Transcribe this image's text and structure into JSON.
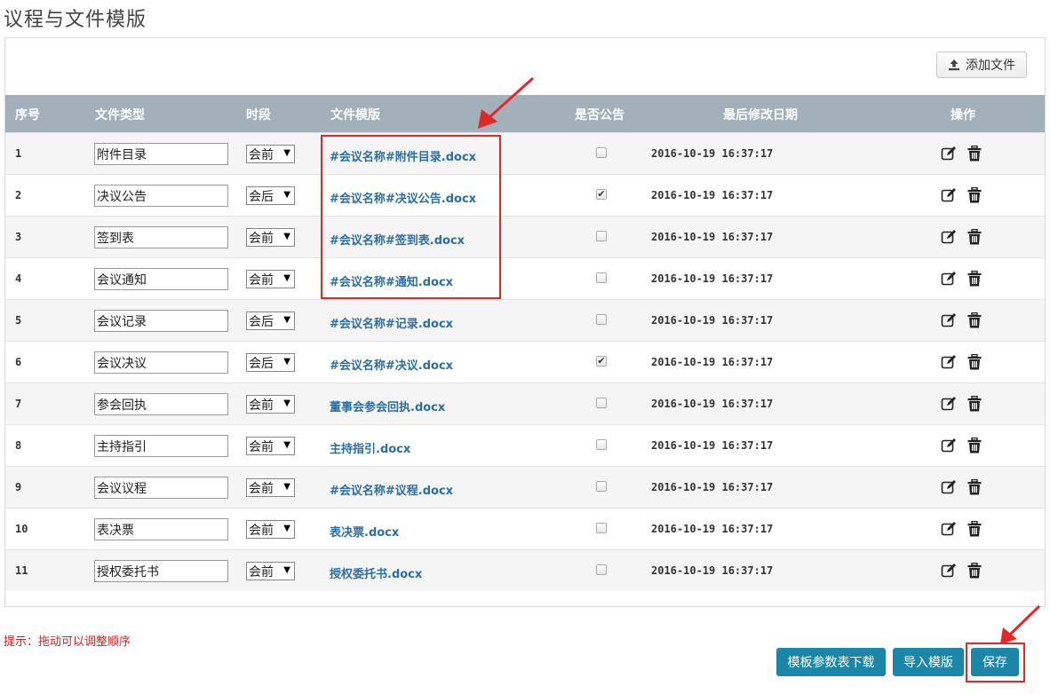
{
  "page": {
    "title": "议程与文件模版",
    "add_file_label": "添加文件",
    "hint": "提示：拖动可以调整顺序"
  },
  "table": {
    "headers": {
      "no": "序号",
      "type": "文件类型",
      "period": "时段",
      "template": "文件模版",
      "public": "是否公告",
      "modified": "最后修改日期",
      "actions": "操作"
    },
    "rows": [
      {
        "no": "1",
        "type": "附件目录",
        "period": "会前",
        "file": "#会议名称#附件目录.docx",
        "public": false,
        "date": "2016-10-19 16:37:17"
      },
      {
        "no": "2",
        "type": "决议公告",
        "period": "会后",
        "file": "#会议名称#决议公告.docx",
        "public": true,
        "date": "2016-10-19 16:37:17"
      },
      {
        "no": "3",
        "type": "签到表",
        "period": "会前",
        "file": "#会议名称#签到表.docx",
        "public": false,
        "date": "2016-10-19 16:37:17"
      },
      {
        "no": "4",
        "type": "会议通知",
        "period": "会前",
        "file": "#会议名称#通知.docx",
        "public": false,
        "date": "2016-10-19 16:37:17"
      },
      {
        "no": "5",
        "type": "会议记录",
        "period": "会后",
        "file": "#会议名称#记录.docx",
        "public": false,
        "date": "2016-10-19 16:37:17"
      },
      {
        "no": "6",
        "type": "会议决议",
        "period": "会后",
        "file": "#会议名称#决议.docx",
        "public": true,
        "date": "2016-10-19 16:37:17"
      },
      {
        "no": "7",
        "type": "参会回执",
        "period": "会前",
        "file": "董事会参会回执.docx",
        "public": false,
        "date": "2016-10-19 16:37:17"
      },
      {
        "no": "8",
        "type": "主持指引",
        "period": "会前",
        "file": "主持指引.docx",
        "public": false,
        "date": "2016-10-19 16:37:17"
      },
      {
        "no": "9",
        "type": "会议议程",
        "period": "会前",
        "file": "#会议名称#议程.docx",
        "public": false,
        "date": "2016-10-19 16:37:17"
      },
      {
        "no": "10",
        "type": "表决票",
        "period": "会前",
        "file": "表决票.docx",
        "public": false,
        "date": "2016-10-19 16:37:17"
      },
      {
        "no": "11",
        "type": "授权委托书",
        "period": "会前",
        "file": "授权委托书.docx",
        "public": false,
        "date": "2016-10-19 16:37:17"
      }
    ]
  },
  "buttons": {
    "download_params": "模板参数表下载",
    "import_template": "导入模版",
    "save": "保存"
  },
  "icons": {
    "upload": "upload-icon",
    "edit": "edit-icon",
    "delete": "trash-icon",
    "select_arrow": "▼",
    "check": "✔"
  },
  "colors": {
    "header_bg": "#a2b0bb",
    "link": "#2a6ea6",
    "button": "#1b86a8",
    "annotation": "#e02828"
  }
}
